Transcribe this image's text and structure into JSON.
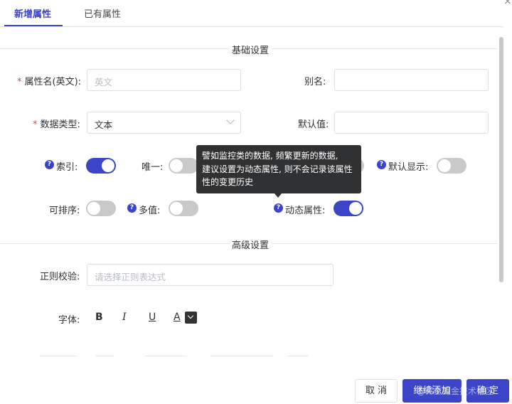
{
  "tabs": [
    {
      "label": "新增属性",
      "active": true
    },
    {
      "label": "已有属性",
      "active": false
    }
  ],
  "sections": {
    "basic": "基础设置",
    "advanced": "高级设置"
  },
  "fields": {
    "attr_name": {
      "label": "属性名(英文):",
      "placeholder": "英文",
      "required": true
    },
    "alias": {
      "label": "别名:",
      "value": ""
    },
    "data_type": {
      "label": "数据类型:",
      "value": "文本",
      "required": true
    },
    "default_value": {
      "label": "默认值:",
      "value": ""
    },
    "regex": {
      "label": "正则校验:",
      "placeholder": "请选择正则表达式"
    },
    "font": {
      "label": "字体:"
    }
  },
  "switches": {
    "index": {
      "label": "索引:",
      "on": true
    },
    "unique": {
      "label": "唯一:",
      "on": false
    },
    "default_show": {
      "label": "默认显示:",
      "on": false
    },
    "sortable": {
      "label": "可排序:",
      "on": false
    },
    "multi": {
      "label": "多值:",
      "on": false
    },
    "dynamic": {
      "label": "动态属性:",
      "on": true
    }
  },
  "tooltip": {
    "lines": [
      "譬如监控类的数据, 频繁更新的数据,",
      "建议设置为动态属性, 则不会记录该属性",
      "性的变更历史"
    ]
  },
  "font_toolbar": {
    "bold": "B",
    "italic": "I",
    "underline": "U",
    "color": "A"
  },
  "buttons": {
    "cancel": "取 消",
    "continue": "继续添加",
    "ok": "确 定"
  },
  "watermark": "@稀土掘金技术社区",
  "close_symbol": "×",
  "colors": {
    "primary": "#3c44c8",
    "required": "#e0463c",
    "toggle_off": "#c9c9c9",
    "tooltip_bg": "#303133"
  }
}
